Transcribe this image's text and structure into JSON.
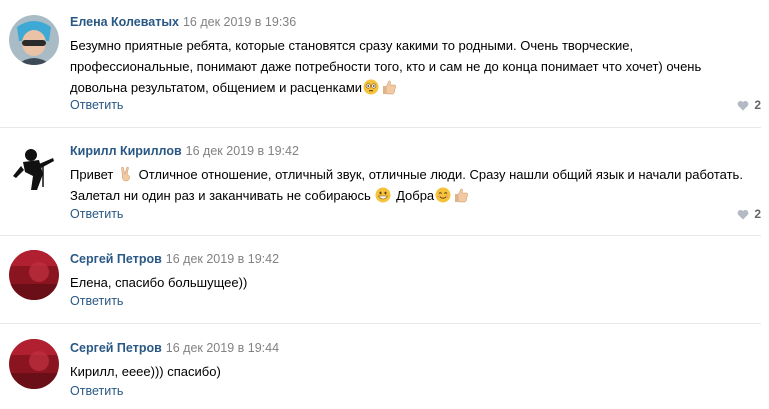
{
  "comments": [
    {
      "author": "Елена Колеватых",
      "date": "16 дек 2019 в 19:36",
      "lines": [
        "Безумно приятные ребята, которые становятся сразу какими то родными. Очень творческие,",
        "профессиональные, понимают даже потребности того, кто и сам не до конца понимает что хочет) очень",
        "довольна результатом, общением и расценками"
      ],
      "reply": "Ответить",
      "likes": "2",
      "emojis": [
        "flushed-face-emoji",
        "thumbs-up-emoji"
      ]
    },
    {
      "author": "Кирилл Кириллов",
      "date": "16 дек 2019 в 19:42",
      "line1_a": "Привет",
      "line1_b": " Отличное отношение, отличный звук, отличные люди. Сразу нашли общий язык и начали работать.",
      "line2_a": "Залетал ни один раз и заканчивать не собираюсь ",
      "line2_b": " Добра",
      "reply": "Ответить",
      "likes": "2",
      "emojis": [
        "victory-hand-emoji",
        "grinning-face-emoji",
        "smiling-face-emoji",
        "thumbs-up-emoji"
      ]
    },
    {
      "author": "Сергей Петров",
      "date": "16 дек 2019 в 19:42",
      "text": "Елена, спасибо большущее))",
      "reply": "Ответить"
    },
    {
      "author": "Сергей Петров",
      "date": "16 дек 2019 в 19:44",
      "text": "Кирилл, ееее))) спасибо)",
      "reply": "Ответить"
    }
  ],
  "colors": {
    "author": "#2a5885",
    "date": "#828282",
    "reply": "#2a5885",
    "separator": "#e7e8ec"
  }
}
